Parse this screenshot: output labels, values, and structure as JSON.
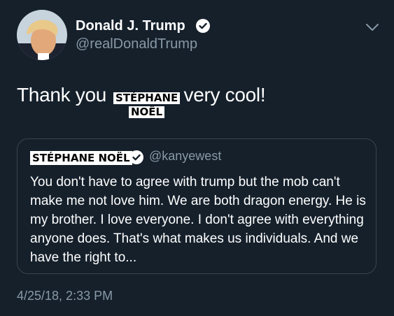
{
  "author": {
    "display_name": "Donald J. Trump",
    "handle": "@realDonaldTrump"
  },
  "tweet": {
    "text_before": "Thank you ",
    "sticker_line1": "STÉPHANE",
    "sticker_line2": "NOËL",
    "text_after": ", very cool!",
    "timestamp": "4/25/18, 2:33 PM"
  },
  "quoted_tweet": {
    "name_sticker": "STÉPHANE NOËL",
    "handle": "@kanyewest",
    "text": "You don't have to agree with trump but the mob can't make me not love him. We are both dragon energy. He is my brother. I love everyone. I don't agree with everything anyone does. That's what makes us individuals. And we have the right to..."
  },
  "icons": {
    "verified": "verified-badge-icon",
    "menu": "chevron-down-icon"
  },
  "colors": {
    "background": "#15202b",
    "text": "#ffffff",
    "secondary_text": "#8899a6",
    "card_border": "#38444d"
  }
}
